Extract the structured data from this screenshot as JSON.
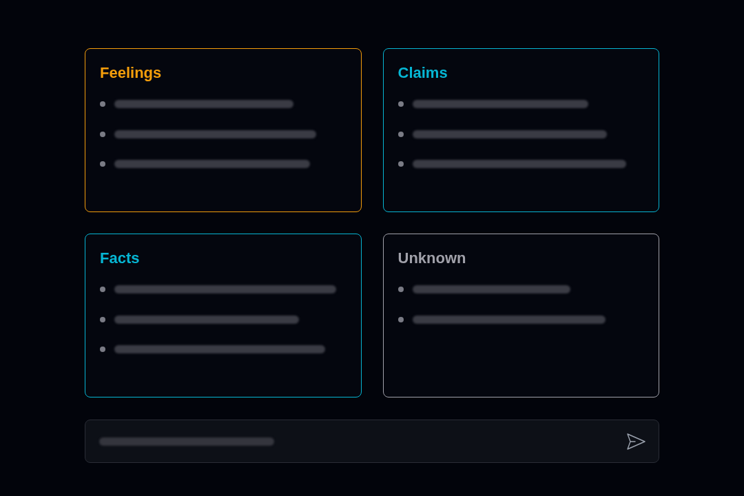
{
  "cards": [
    {
      "title": "Feelings",
      "color": "#f59e0b",
      "items": [
        {
          "kind": "redacted"
        },
        {
          "kind": "redacted"
        },
        {
          "kind": "redacted"
        }
      ]
    },
    {
      "title": "Claims",
      "color": "#06b6d4",
      "items": [
        {
          "kind": "redacted"
        },
        {
          "kind": "redacted"
        },
        {
          "kind": "redacted"
        }
      ]
    },
    {
      "title": "Facts",
      "color": "#06b6d4",
      "items": [
        {
          "kind": "redacted"
        },
        {
          "kind": "redacted"
        },
        {
          "kind": "redacted"
        }
      ]
    },
    {
      "title": "Unknown",
      "color": "#a1a1aa",
      "items": [
        {
          "kind": "redacted"
        },
        {
          "kind": "redacted"
        }
      ]
    }
  ],
  "composer": {
    "hint": {
      "kind": "redacted"
    }
  }
}
